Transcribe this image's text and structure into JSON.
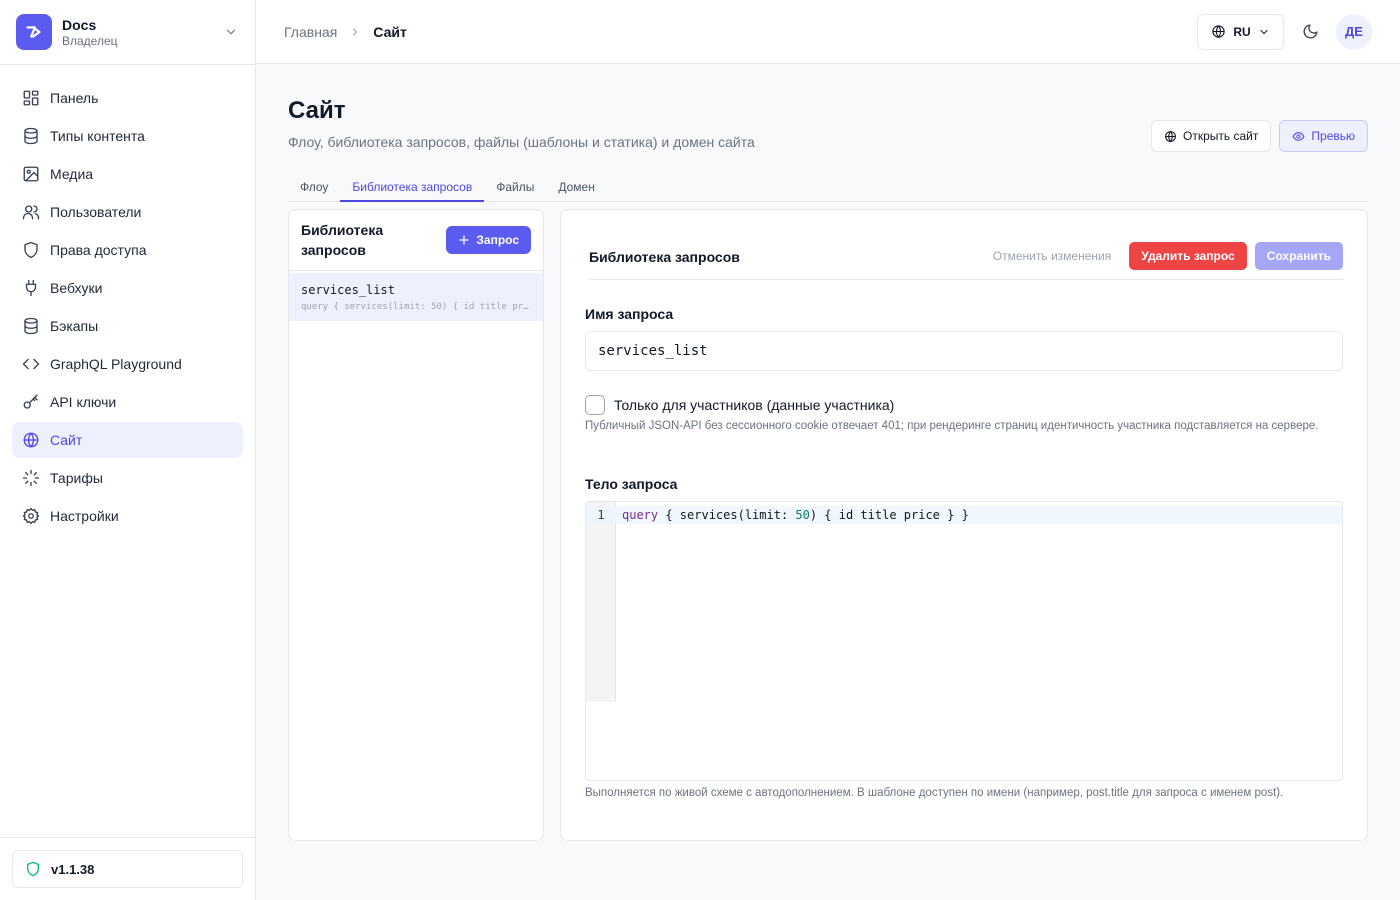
{
  "workspace": {
    "name": "Docs",
    "role": "Владелец"
  },
  "sidebar": {
    "items": [
      {
        "label": "Панель",
        "icon": "dashboard-icon"
      },
      {
        "label": "Типы контента",
        "icon": "database-icon"
      },
      {
        "label": "Медиа",
        "icon": "image-icon"
      },
      {
        "label": "Пользователи",
        "icon": "users-icon"
      },
      {
        "label": "Права доступа",
        "icon": "shield-icon"
      },
      {
        "label": "Вебхуки",
        "icon": "plug-icon"
      },
      {
        "label": "Бэкапы",
        "icon": "database-icon"
      },
      {
        "label": "GraphQL Playground",
        "icon": "code-icon"
      },
      {
        "label": "API ключи",
        "icon": "key-icon"
      },
      {
        "label": "Сайт",
        "icon": "globe-icon",
        "active": true
      },
      {
        "label": "Тарифы",
        "icon": "loader-icon"
      },
      {
        "label": "Настройки",
        "icon": "gear-icon"
      }
    ],
    "version": "v1.1.38"
  },
  "header": {
    "breadcrumb_home": "Главная",
    "breadcrumb_current": "Сайт",
    "language": "RU",
    "avatar_initials": "ДЕ"
  },
  "page": {
    "title": "Сайт",
    "subtitle": "Флоу, библиотека запросов, файлы (шаблоны и статика) и домен сайта",
    "open_site_label": "Открыть сайт",
    "preview_label": "Превью"
  },
  "tabs": [
    {
      "label": "Флоу",
      "active": false
    },
    {
      "label": "Библиотека запросов",
      "active": true
    },
    {
      "label": "Файлы",
      "active": false
    },
    {
      "label": "Домен",
      "active": false
    }
  ],
  "query_list": {
    "title": "Библиотека запросов",
    "add_label": "Запрос",
    "items": [
      {
        "name": "services_list",
        "preview": "query { services(limit: 50) { id title price } }"
      }
    ]
  },
  "editor": {
    "title": "Библиотека запросов",
    "cancel_label": "Отменить изменения",
    "delete_label": "Удалить запрос",
    "save_label": "Сохранить",
    "name_label": "Имя запроса",
    "name_value": "services_list",
    "members_only_label": "Только для участников (данные участника)",
    "members_only_checked": false,
    "members_only_hint": "Публичный JSON-API без сессионного cookie отвечает 401; при рендеринге страниц идентичность участника подставляется на сервере.",
    "body_label": "Тело запроса",
    "body_code": {
      "line_number": "1",
      "keyword": "query",
      "text_before_number": " { services(limit: ",
      "number": "50",
      "text_after_number": ") { id title price } }"
    },
    "body_hint": "Выполняется по живой схеме с автодополнением. В шаблоне доступен по имени (например, post.title для запроса с именем post)."
  },
  "colors": {
    "accent": "#5b5bf0",
    "accent_light": "#eef0fe",
    "danger": "#ef4444",
    "save_disabled": "#a5a6f6"
  }
}
